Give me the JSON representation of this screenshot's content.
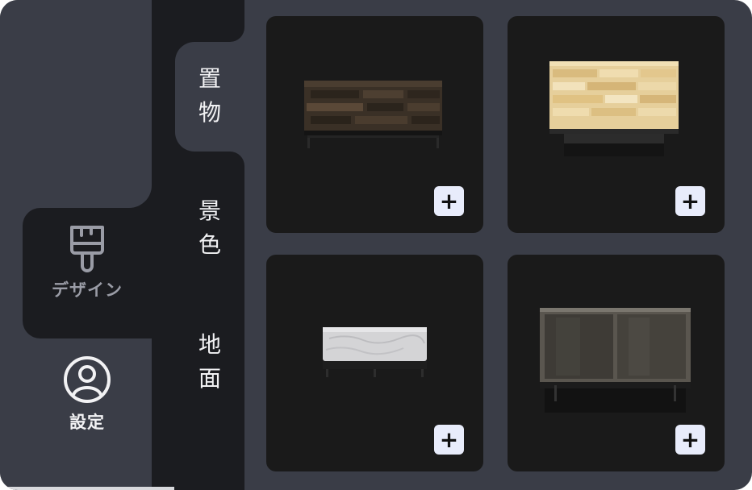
{
  "nav": {
    "items": [
      {
        "label": "デザイン",
        "icon": "paint-brush-icon",
        "active": true
      },
      {
        "label": "設定",
        "icon": "user-circle-icon",
        "active": false
      }
    ]
  },
  "categories": [
    {
      "label_chars": [
        "置",
        "物"
      ],
      "active": true
    },
    {
      "label_chars": [
        "景",
        "色"
      ],
      "active": false
    },
    {
      "label_chars": [
        "地",
        "面"
      ],
      "active": false
    }
  ],
  "items": [
    {
      "name": "dark-wood-tv-stand",
      "add_label": "+"
    },
    {
      "name": "light-wood-table",
      "add_label": "+"
    },
    {
      "name": "white-marble-bench",
      "add_label": "+"
    },
    {
      "name": "dark-glass-cabinet",
      "add_label": "+"
    }
  ],
  "colors": {
    "panel_bg": "#3a3d47",
    "rail_dark": "#1b1c20",
    "card_bg": "#1a1a1a",
    "add_button": "#e8ecfb"
  }
}
